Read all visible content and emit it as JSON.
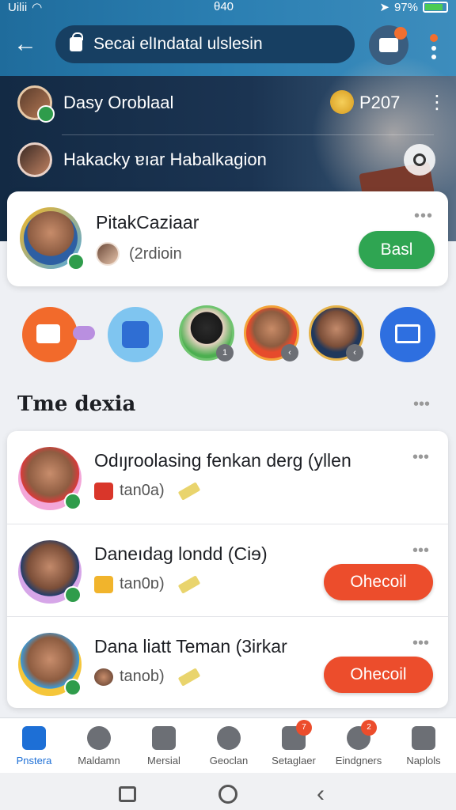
{
  "status_bar": {
    "carrier": "Uilii",
    "time": "θ40",
    "battery": "97%"
  },
  "header": {
    "search_text": "Secai elIndatal ulslesin"
  },
  "top_rows": [
    {
      "name": "Dasy Oroblaal",
      "coins": "P207"
    },
    {
      "name": "Hakacky ɐıar Habalkagion"
    }
  ],
  "profile_card": {
    "name": "PitakCaziaar",
    "sub": "(2rdioin",
    "button": "Basl"
  },
  "circle_badges": [
    "1",
    "‹",
    "‹"
  ],
  "section": {
    "title": "Tme dexia"
  },
  "list": [
    {
      "title": "Odıȷroolasing fenkan derg (yllen",
      "meta": "tan0a)"
    },
    {
      "title": "Daneıdag londd (Ciɘ)",
      "meta": "tan0ɒ)",
      "button": "Ohecoil"
    },
    {
      "title": "Dana liatt Teman (3irkar",
      "meta": "tanob)",
      "button": "Ohecoil"
    }
  ],
  "bottom_nav": [
    {
      "label": "Pnstera",
      "icon": "home-icon",
      "active": true
    },
    {
      "label": "Maldamn",
      "icon": "palette-icon"
    },
    {
      "label": "Mersial",
      "icon": "clipboard-icon"
    },
    {
      "label": "Geoclan",
      "icon": "gauge-icon"
    },
    {
      "label": "Setaglaer",
      "icon": "inbox-icon",
      "badge": "7"
    },
    {
      "label": "Eindgners",
      "icon": "heart-icon",
      "badge": "2"
    },
    {
      "label": "Naplols",
      "icon": "bag-icon"
    }
  ],
  "colors": {
    "accent_blue": "#1d6fd6",
    "green": "#2fa552",
    "orange": "#ec4d2c"
  }
}
